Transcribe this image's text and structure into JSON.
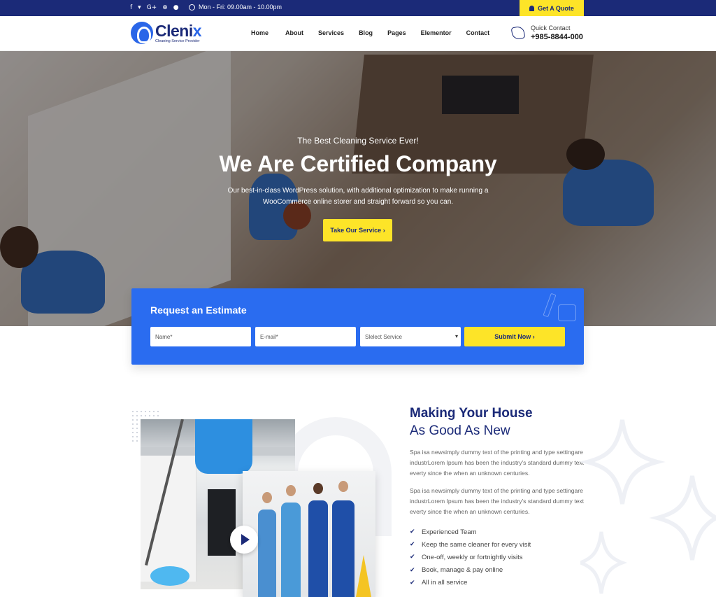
{
  "topbar": {
    "social_icons": [
      "facebook-icon",
      "twitter-icon",
      "google-plus-icon",
      "pinterest-icon",
      "skype-icon"
    ],
    "social_glyphs": [
      "f",
      "🐦",
      "G+",
      "⊕",
      "☁"
    ],
    "hours": "Mon - Fri: 09.00am - 10.00pm",
    "quote_label": "Get A Quote"
  },
  "header": {
    "logo_name_main": "Cleni",
    "logo_name_accent": "x",
    "logo_tagline": "Cleaning Service Provider",
    "nav": [
      {
        "label": "Home"
      },
      {
        "label": "About"
      },
      {
        "label": "Services"
      },
      {
        "label": "Blog"
      },
      {
        "label": "Pages"
      },
      {
        "label": "Elementor"
      },
      {
        "label": "Contact"
      }
    ],
    "contact_label": "Quick Contact",
    "contact_number": "+985-8844-000"
  },
  "hero": {
    "subtitle": "The Best Cleaning Service Ever!",
    "title": "We Are Certified Company",
    "description": "Our best-in-class WordPress solution, with additional optimization to make running a WooCommerce online storer and straight forward so you can.",
    "button_label": "Take Our Service ›"
  },
  "estimate": {
    "title": "Request an Estimate",
    "name_placeholder": "Name*",
    "email_placeholder": "E-mail*",
    "service_placeholder": "Slelect Service",
    "submit_label": "Submit Now ›"
  },
  "about": {
    "title_line1": "Making Your House",
    "title_line2": "As Good As New",
    "paragraph1": "Spa isa newsimply dummy text of the printing and type settingare industrLorem Ipsum has been the industry's standard dummy text everty since the when an unknown centuries.",
    "paragraph2": "Spa isa newsimply dummy text of the printing and type settingare industrLorem Ipsum has been the industry's standard dummy text everty since the when an unknown centuries.",
    "checklist": [
      "Experienced Team",
      "Keep the same cleaner for every visit",
      "One-off, weekly or fortnightly visits",
      "Book, manage & pay online",
      "All in all service"
    ]
  },
  "colors": {
    "navy": "#1b2a78",
    "blue": "#2a6cf0",
    "yellow": "#fde428"
  }
}
